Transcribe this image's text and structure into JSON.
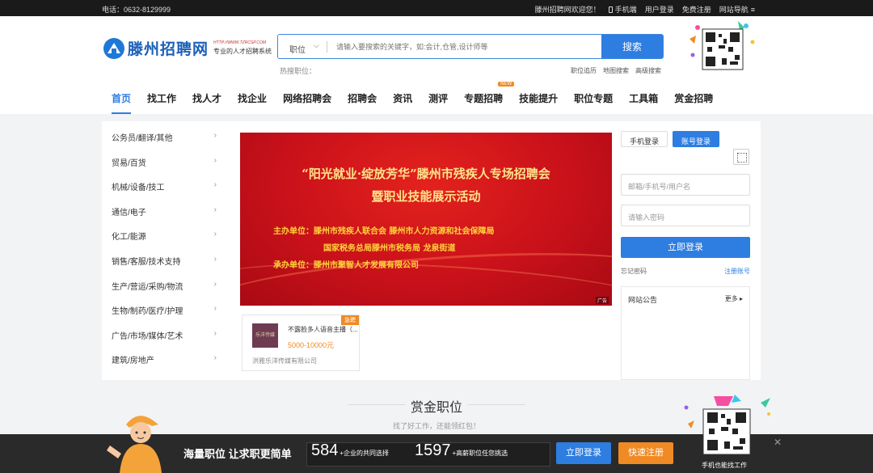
{
  "topbar": {
    "phone": "电话：0632-8129999",
    "welcome": "滕州招聘网欢迎您！",
    "mobile": "手机端",
    "login": "用户登录",
    "register": "免费注册",
    "site_nav": "网站导航"
  },
  "logo": {
    "name": "滕州招聘网",
    "url": "HTTP://WWW.TZRCSP.COM",
    "slogan": "专业的人才招聘系统"
  },
  "search": {
    "category": "职位",
    "placeholder": "请输入要搜索的关键字，如:会计,仓管,设计师等",
    "button": "搜索",
    "hot_label": "热搜职位：",
    "links": [
      "职位追历",
      "地图搜索",
      "高级搜索"
    ]
  },
  "nav": {
    "items": [
      "首页",
      "找工作",
      "找人才",
      "找企业",
      "网络招聘会",
      "招聘会",
      "资讯",
      "测评",
      "专题招聘",
      "技能提升",
      "职位专题",
      "工具箱",
      "赏金招聘"
    ],
    "new_tag": "NEW"
  },
  "categories": [
    "公务员/翻译/其他",
    "贸易/百货",
    "机械/设备/技工",
    "通信/电子",
    "化工/能源",
    "销售/客服/技术支持",
    "生产/营运/采购/物流",
    "生物/制药/医疗/护理",
    "广告/市场/媒体/艺术",
    "建筑/房地产"
  ],
  "banner": {
    "title1": "“阳光就业·绽放芳华”滕州市残疾人专场招聘会",
    "title2": "暨职业技能展示活动",
    "line1": "主办单位：滕州市残疾人联合会   滕州市人力资源和社会保障局",
    "line2": "国家税务总局滕州市税务局   龙泉街道",
    "line3": "承办单位：滕州市聚智人才发展有限公司",
    "ad": "广告"
  },
  "job": {
    "thumb_text": "乐洋传媒",
    "title": "不露脸多人语音主播（...",
    "salary": "5000-10000元",
    "company": "洪雅乐洋传媒有限公司",
    "urgent": "急聘"
  },
  "login": {
    "tab_phone": "手机登录",
    "tab_account": "账号登录",
    "user_placeholder": "邮箱/手机号/用户名",
    "pass_placeholder": "请输入密码",
    "submit": "立即登录",
    "forgot": "忘记密码",
    "register": "注册账号"
  },
  "notice": {
    "title": "网站公告",
    "more": "更多"
  },
  "bounty": {
    "title": "赏金职位",
    "subtitle": "找了好工作，还能领红包！"
  },
  "bottom_bar": {
    "slogan": "海量职位 让求职更简单",
    "stat1_num": "584",
    "stat1_label": "+企业的共同选择",
    "stat2_num": "1597",
    "stat2_label": "+高薪职位任您挑选",
    "login_btn": "立即登录",
    "register_btn": "快速注册"
  },
  "float_qr": {
    "caption": "手机也能找工作"
  },
  "colors": {
    "primary": "#2e7de1",
    "accent": "#f08a24",
    "banner_red": "#c9111a",
    "banner_text": "#ffe38a"
  }
}
